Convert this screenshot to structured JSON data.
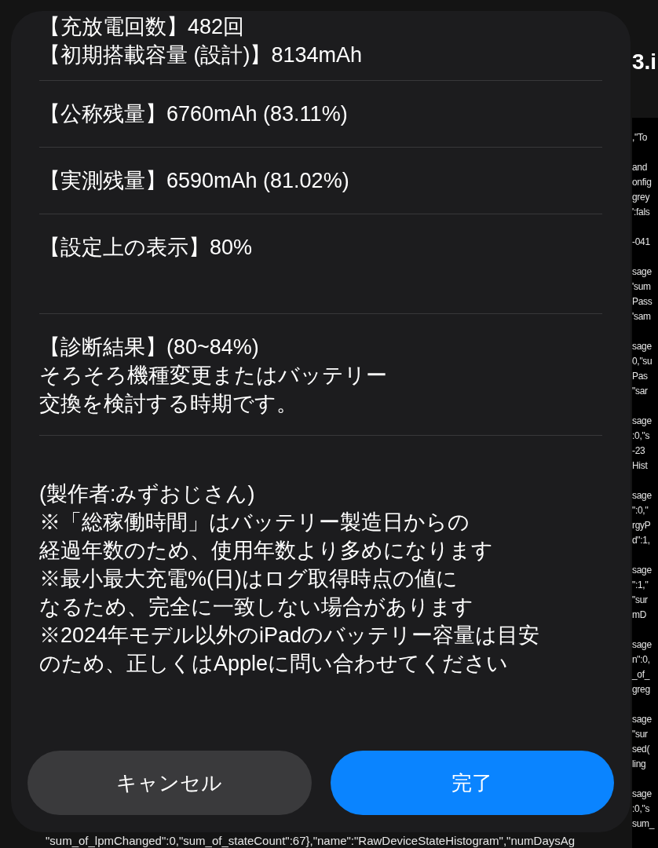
{
  "background": {
    "title": "3.i",
    "log_groups": [
      [
        ",\"To"
      ],
      [
        "and",
        "onfig",
        "grey",
        "':fals"
      ],
      [
        "-041"
      ],
      [
        "sage",
        "'sum",
        "Pass",
        "'sam"
      ],
      [
        "sage",
        "0,\"su",
        "Pas",
        "\"sar"
      ],
      [
        "sage",
        ":0,\"s",
        "-23",
        "Hist"
      ],
      [
        "sage",
        "\":0,\"",
        "rgyP",
        "d\":1,"
      ],
      [
        "sage",
        "\":1,\"",
        "\"sur",
        "mD"
      ],
      [
        "sage",
        "n\":0,",
        "_of_",
        "greg"
      ],
      [
        "sage",
        "\"sur",
        "sed(",
        "ling"
      ],
      [
        "sage",
        ":0,\"s",
        "sum_"
      ]
    ],
    "bottom_line": "\"sum_of_lpmChanged\":0,\"sum_of_stateCount\":67},\"name\":\"RawDeviceStateHistogram\",\"numDaysAg"
  },
  "dialog": {
    "sections": [
      {
        "lines": [
          "【充放電回数】482回",
          "【初期搭載容量 (設計)】8134mAh"
        ]
      },
      {
        "lines": [
          "【公称残量】6760mAh (83.11%)"
        ]
      },
      {
        "lines": [
          "【実測残量】6590mAh (81.02%)"
        ]
      },
      {
        "lines": [
          "【設定上の表示】80%"
        ]
      },
      {
        "lines": [
          "【診断結果】(80~84%)",
          "そろそろ機種変更またはバッテリー",
          "交換を検討する時期です。"
        ]
      },
      {
        "lines": [
          "(製作者:みずおじさん)",
          "※「総稼働時間」はバッテリー製造日からの",
          "経過年数のため、使用年数より多めになります",
          "※最小最大充電%(日)はログ取得時点の値に",
          "なるため、完全に一致しない場合があります",
          "※2024年モデル以外のiPadのバッテリー容量は目安",
          "のため、正しくはAppleに問い合わせてください"
        ]
      }
    ],
    "buttons": [
      {
        "label": "キャンセル",
        "kind": "secondary"
      },
      {
        "label": "完了",
        "kind": "primary"
      }
    ]
  }
}
